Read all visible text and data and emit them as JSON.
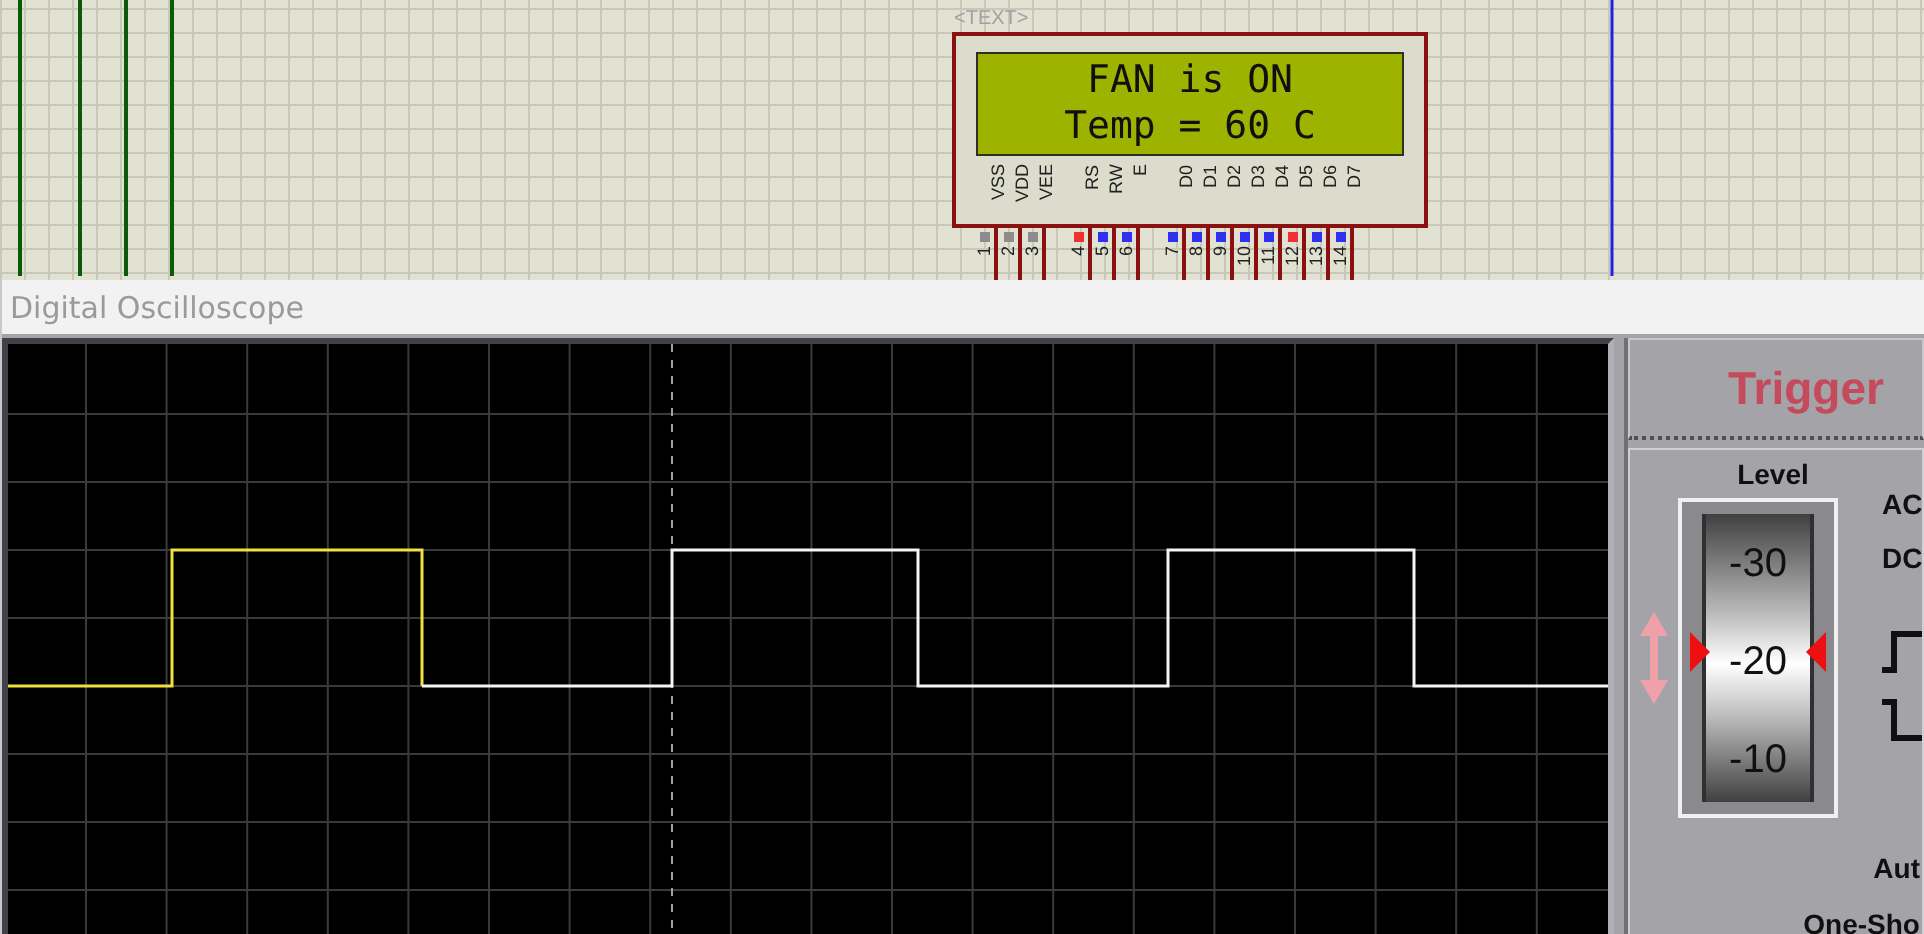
{
  "schematic": {
    "component_ref": "<TEXT>",
    "lcd_lines": [
      "FAN is ON",
      "Temp = 60 C"
    ],
    "pins": [
      {
        "name": "VSS",
        "number": "1",
        "color": "#8c8c8c"
      },
      {
        "name": "VDD",
        "number": "2",
        "color": "#8c8c8c"
      },
      {
        "name": "VEE",
        "number": "3",
        "color": "#8c8c8c"
      },
      {
        "name": "RS",
        "number": "4",
        "color": "#f03030"
      },
      {
        "name": "RW",
        "number": "5",
        "color": "#3030f0"
      },
      {
        "name": "E",
        "number": "6",
        "color": "#3030f0"
      },
      {
        "name": "D0",
        "number": "7",
        "color": "#3030f0"
      },
      {
        "name": "D1",
        "number": "8",
        "color": "#3030f0"
      },
      {
        "name": "D2",
        "number": "9",
        "color": "#3030f0"
      },
      {
        "name": "D3",
        "number": "10",
        "color": "#3030f0"
      },
      {
        "name": "D4",
        "number": "11",
        "color": "#3030f0"
      },
      {
        "name": "D5",
        "number": "12",
        "color": "#f03030"
      },
      {
        "name": "D6",
        "number": "13",
        "color": "#3030f0"
      },
      {
        "name": "D7",
        "number": "14",
        "color": "#3030f0"
      }
    ]
  },
  "oscilloscope": {
    "title": "Digital Oscilloscope",
    "trigger": {
      "heading": "Trigger",
      "level_label": "Level",
      "scale": [
        "-30",
        "-20",
        "-10"
      ],
      "coupling": [
        "AC",
        "DC"
      ],
      "modes": [
        "Aut",
        "One-Sho"
      ]
    }
  }
}
